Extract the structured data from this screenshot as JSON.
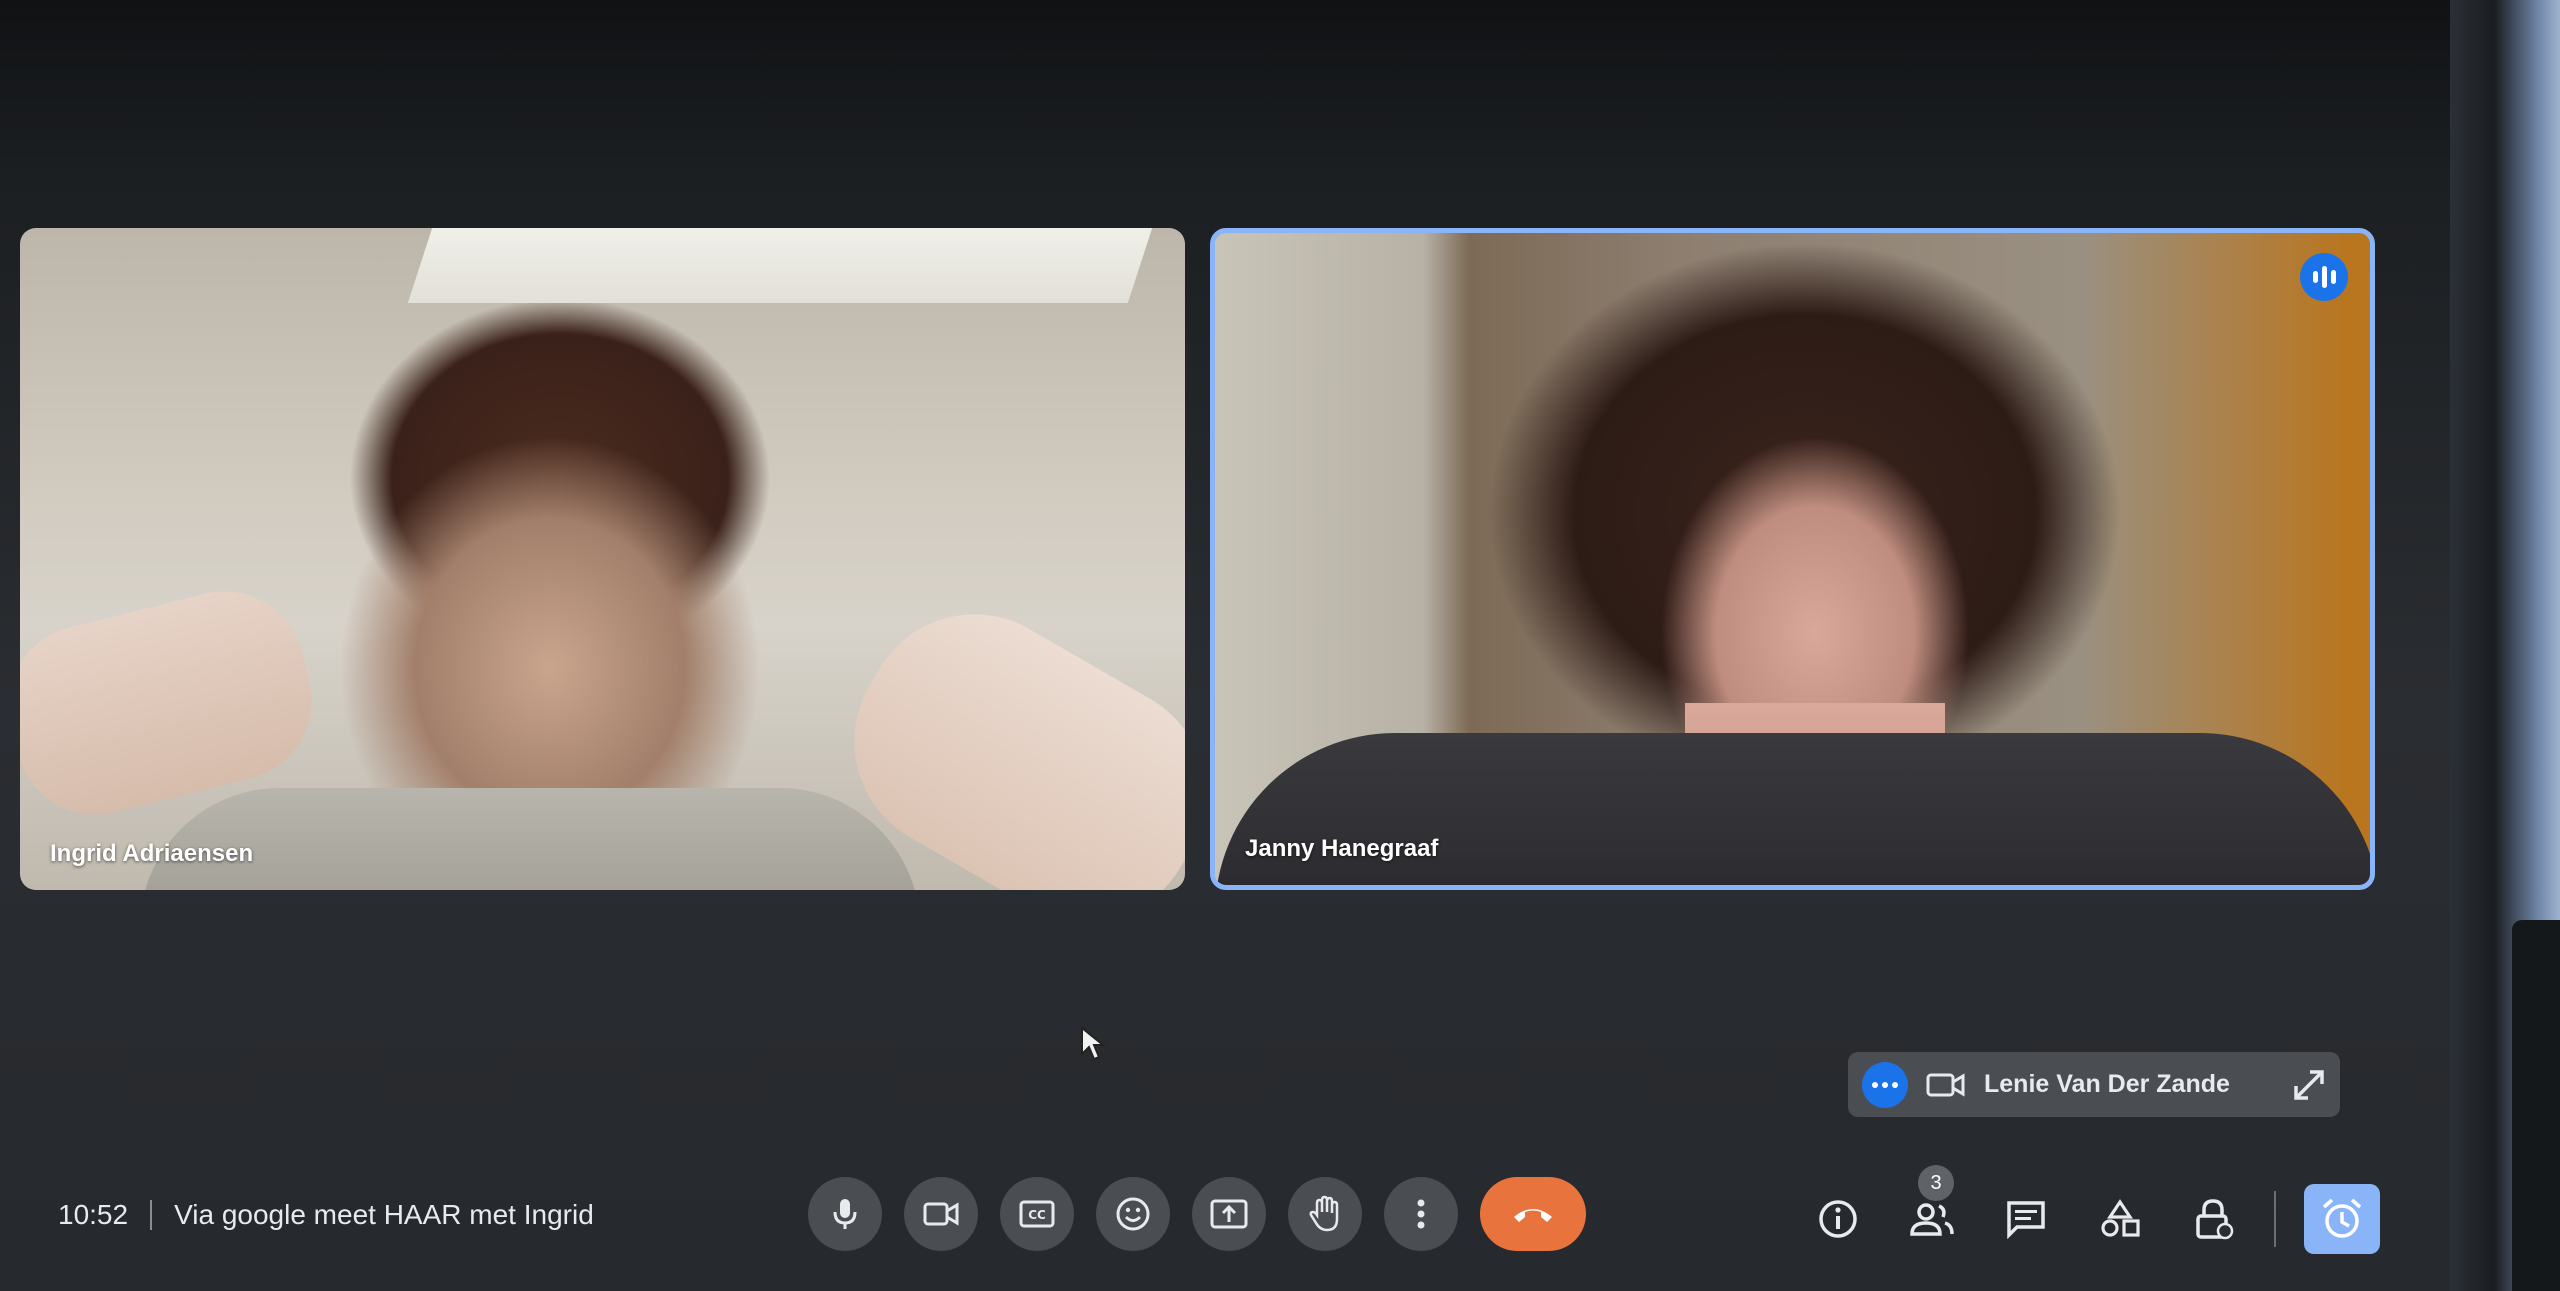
{
  "participants": [
    {
      "name": "Ingrid Adriaensen",
      "speaking": false
    },
    {
      "name": "Janny Hanegraaf",
      "speaking": true
    }
  ],
  "self_view": {
    "name": "Lenie Van Der Zande",
    "icons": [
      "more-options-icon",
      "camera-icon",
      "expand-icon"
    ]
  },
  "meeting": {
    "time": "10:52",
    "title": "Via google meet HAAR met Ingrid"
  },
  "controls": [
    "mic-icon",
    "camera-icon",
    "captions-icon",
    "emoji-icon",
    "present-icon",
    "raise-hand-icon",
    "more-vert-icon",
    "end-call-icon"
  ],
  "side_controls": {
    "people_count": "3",
    "icons": [
      "info-icon",
      "people-icon",
      "chat-icon",
      "activities-icon",
      "host-controls-icon",
      "alarm-icon"
    ]
  },
  "colors": {
    "active_border": "#8ab4f8",
    "speaking_blue": "#1a73e8",
    "end_call": "#e8733d",
    "button_bg": "#4a4d52"
  }
}
